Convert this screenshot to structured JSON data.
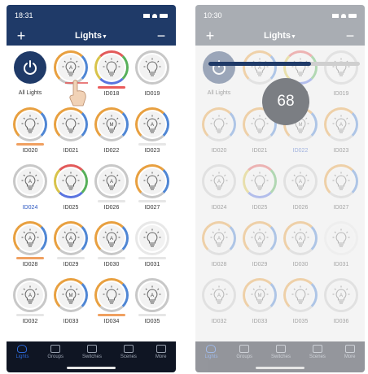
{
  "screens": [
    {
      "status_time": "18:31",
      "title": "Lights",
      "add_glyph": "+",
      "remove_glyph": "−",
      "tiles": [
        {
          "kind": "power",
          "label": "All Lights",
          "bar": "none"
        },
        {
          "kind": "bulb-a",
          "label": "",
          "bar": "none",
          "ring": "color"
        },
        {
          "kind": "bulb",
          "label": "ID018",
          "bar": "red",
          "ring": "rainbow"
        },
        {
          "kind": "bulb",
          "label": "ID019",
          "bar": "none",
          "ring": "gray"
        },
        {
          "kind": "bulb",
          "label": "ID020",
          "bar": "orange",
          "ring": "color"
        },
        {
          "kind": "bulb",
          "label": "ID021",
          "bar": "none",
          "ring": "color"
        },
        {
          "kind": "bulb-m",
          "label": "ID022",
          "bar": "none",
          "ring": "color"
        },
        {
          "kind": "bulb-a",
          "label": "ID023",
          "bar": "gray",
          "ring": "color"
        },
        {
          "kind": "bulb-a",
          "label": "ID024",
          "bar": "none",
          "ring": "gray",
          "label_color": "blue"
        },
        {
          "kind": "bulb",
          "label": "ID025",
          "bar": "none",
          "ring": "rainbow"
        },
        {
          "kind": "bulb-a",
          "label": "ID026",
          "bar": "gray",
          "ring": "gray"
        },
        {
          "kind": "bulb",
          "label": "ID027",
          "bar": "gray",
          "ring": "color"
        },
        {
          "kind": "bulb-a",
          "label": "ID028",
          "bar": "orange",
          "ring": "color"
        },
        {
          "kind": "bulb-a",
          "label": "ID029",
          "bar": "gray",
          "ring": "color"
        },
        {
          "kind": "bulb-a",
          "label": "ID030",
          "bar": "gray",
          "ring": "color"
        },
        {
          "kind": "bulb",
          "label": "ID031",
          "bar": "gray",
          "ring": "none"
        },
        {
          "kind": "bulb-a",
          "label": "ID032",
          "bar": "gray",
          "ring": "gray"
        },
        {
          "kind": "bulb-m",
          "label": "ID033",
          "bar": "none",
          "ring": "color"
        },
        {
          "kind": "bulb",
          "label": "ID034",
          "bar": "orange",
          "ring": "color"
        },
        {
          "kind": "bulb-a",
          "label": "ID035",
          "bar": "gray",
          "ring": "gray"
        }
      ],
      "tabs": [
        {
          "label": "Lights",
          "active": true
        },
        {
          "label": "Groups",
          "active": false
        },
        {
          "label": "Switches",
          "active": false
        },
        {
          "label": "Scenes",
          "active": false
        },
        {
          "label": "More",
          "active": false
        }
      ]
    },
    {
      "status_time": "10:30",
      "title": "Lights",
      "add_glyph": "+",
      "remove_glyph": "−",
      "brightness_level": "68",
      "brightness_fraction": 0.68,
      "tiles": [
        {
          "kind": "power",
          "label": "All Lights",
          "bar": "none"
        },
        {
          "kind": "bulb-a",
          "label": "",
          "bar": "none",
          "ring": "color"
        },
        {
          "kind": "bulb",
          "label": "ID018",
          "bar": "none",
          "ring": "rainbow"
        },
        {
          "kind": "bulb",
          "label": "ID019",
          "bar": "none",
          "ring": "gray"
        },
        {
          "kind": "bulb",
          "label": "ID020",
          "bar": "none",
          "ring": "color"
        },
        {
          "kind": "bulb",
          "label": "ID021",
          "bar": "none",
          "ring": "color"
        },
        {
          "kind": "bulb-m",
          "label": "ID022",
          "bar": "none",
          "ring": "color",
          "label_color": "blue"
        },
        {
          "kind": "bulb-a",
          "label": "ID023",
          "bar": "none",
          "ring": "color"
        },
        {
          "kind": "bulb-a",
          "label": "ID024",
          "bar": "none",
          "ring": "gray"
        },
        {
          "kind": "bulb",
          "label": "ID025",
          "bar": "none",
          "ring": "rainbow"
        },
        {
          "kind": "bulb-a",
          "label": "ID026",
          "bar": "none",
          "ring": "gray"
        },
        {
          "kind": "bulb",
          "label": "ID027",
          "bar": "none",
          "ring": "color"
        },
        {
          "kind": "bulb-a",
          "label": "ID028",
          "bar": "none",
          "ring": "color"
        },
        {
          "kind": "bulb-a",
          "label": "ID029",
          "bar": "none",
          "ring": "color"
        },
        {
          "kind": "bulb-a",
          "label": "ID030",
          "bar": "none",
          "ring": "color"
        },
        {
          "kind": "bulb",
          "label": "ID031",
          "bar": "none",
          "ring": "none"
        },
        {
          "kind": "bulb-a",
          "label": "ID032",
          "bar": "none",
          "ring": "gray"
        },
        {
          "kind": "bulb-m",
          "label": "ID033",
          "bar": "none",
          "ring": "color"
        },
        {
          "kind": "bulb",
          "label": "ID035",
          "bar": "none",
          "ring": "color"
        },
        {
          "kind": "bulb-a",
          "label": "ID036",
          "bar": "none",
          "ring": "gray"
        }
      ],
      "tabs": [
        {
          "label": "Lights",
          "active": true
        },
        {
          "label": "Groups",
          "active": false
        },
        {
          "label": "Switches",
          "active": false
        },
        {
          "label": "Scenes",
          "active": false
        },
        {
          "label": "More",
          "active": false
        }
      ]
    }
  ],
  "icons": {
    "add": "plus-icon",
    "remove": "minus-icon",
    "power": "power-icon",
    "bulb": "lightbulb-icon",
    "hand": "pointing-hand-icon"
  }
}
